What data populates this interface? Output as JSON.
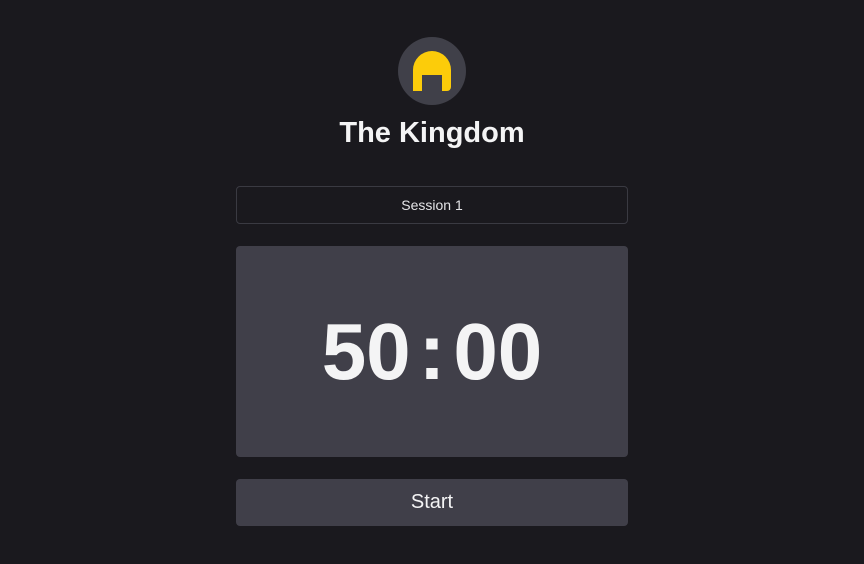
{
  "app": {
    "title": "The Kingdom",
    "logo_icon": "arch-icon",
    "accent": "#fccc0a"
  },
  "session": {
    "value": "Session 1"
  },
  "timer": {
    "minutes": "50",
    "separator": ":",
    "seconds": "00"
  },
  "actions": {
    "start_label": "Start"
  }
}
